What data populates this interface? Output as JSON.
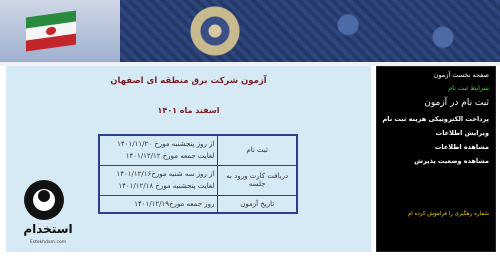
{
  "main": {
    "title": "آزمون شرکت برق منطقه ای اصفهان",
    "subtitle": "اسفند ماه ۱۴۰۱",
    "schedule": [
      {
        "label": "ثبت نام",
        "lines": [
          "از روز پنجشنبه مورخ ۱۴۰۱/۱۱/۲۰",
          "لغایت جمعه مورخ ۱۴۰۱/۱۲/۱۲"
        ]
      },
      {
        "label": "دریافت کارت ورود به جلسه",
        "lines": [
          "از روز سه شنبه مورخ۱۴۰۱/۱۲/۱۶",
          "لغایت پنجشنبه مورخ ۱۴۰۱/۱۲/۱۸"
        ]
      },
      {
        "label": "تاریخ آزمون",
        "lines": [
          "روز جمعه مورخ۱۴۰۱/۱۲/۱۹"
        ]
      }
    ]
  },
  "sidebar": {
    "items": [
      {
        "label": "صفحه نخست آزمون"
      },
      {
        "label": "شرایط ثبت نام"
      },
      {
        "label": "ثبت نام در آزمون"
      },
      {
        "label": "پرداخت الکترونیکی هزینه ثبت نام"
      },
      {
        "label": "ویرایش اطلاعات"
      },
      {
        "label": "مشاهده اطلاعات"
      },
      {
        "label": "مشاهده وضعیت پذیرش"
      },
      {
        "label": "شماره رهگیری را فراموش کرده ام"
      }
    ]
  },
  "logo": {
    "text": "استخدام",
    "domain": "Estekhdam.com"
  },
  "colors": {
    "banner": "#1d2f5c",
    "main_bg": "#d6eaf5",
    "title": "#7a1e24",
    "table_border": "#2f3d90",
    "sidebar_bg": "#000000",
    "sidebar_green": "#36d13a",
    "sidebar_yellow": "#f0d400"
  },
  "icons": [
    "iran-flag-icon",
    "persian-carpet-pattern",
    "estekhdam-logo-icon"
  ]
}
